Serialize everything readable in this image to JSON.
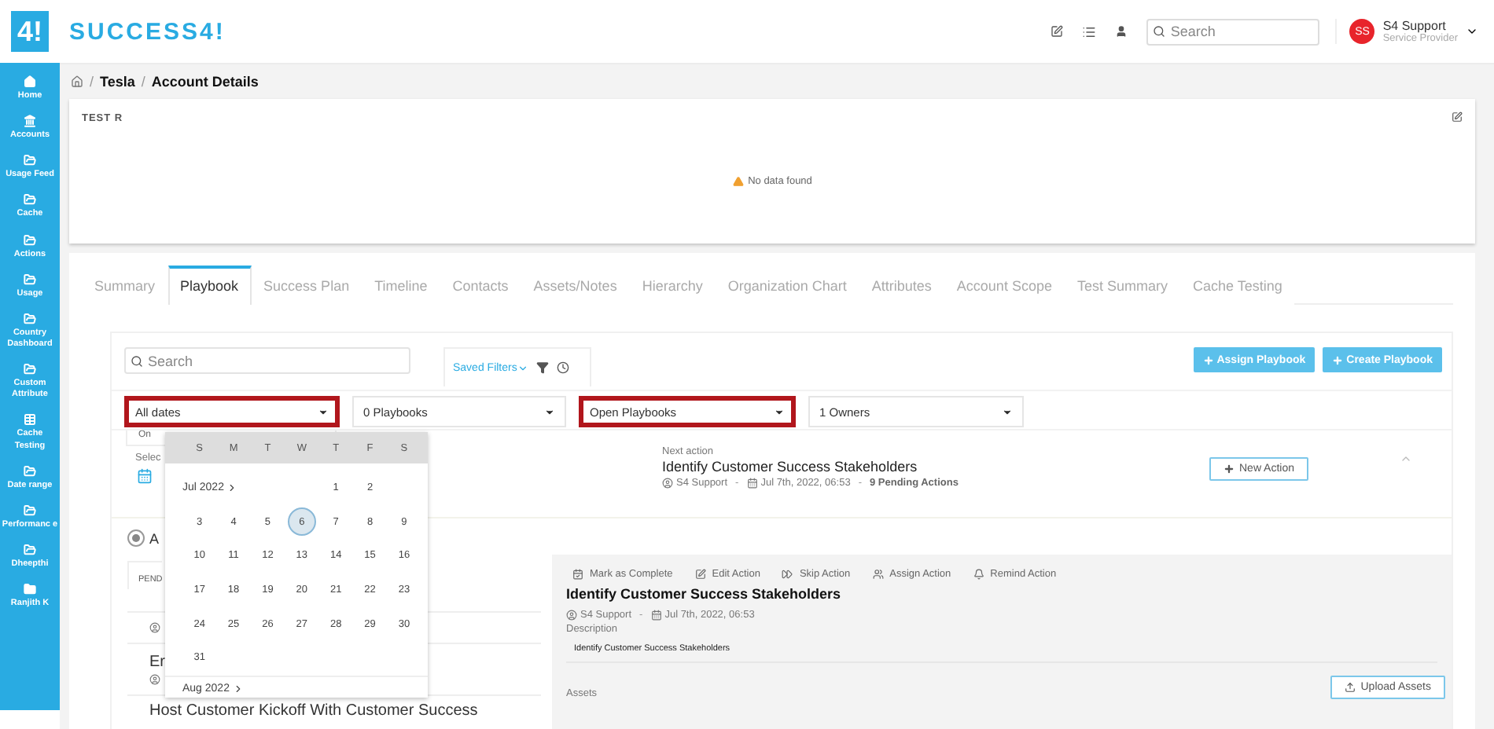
{
  "sidebar": {
    "logo_mark": "4!",
    "items": [
      {
        "label": "Home",
        "kind": "home"
      },
      {
        "label": "Accounts",
        "kind": "bank"
      },
      {
        "label": "Usage Feed",
        "kind": "folder"
      },
      {
        "label": "Cache",
        "kind": "folder"
      },
      {
        "label": "Actions",
        "kind": "folder"
      },
      {
        "label": "Usage",
        "kind": "folder"
      },
      {
        "label": "Country Dashboard",
        "kind": "folder"
      },
      {
        "label": "Custom Attribute",
        "kind": "folder"
      },
      {
        "label": "Cache Testing",
        "kind": "table"
      },
      {
        "label": "Date range",
        "kind": "folder"
      },
      {
        "label": "Performanc e",
        "kind": "folder"
      },
      {
        "label": "Dheepthi",
        "kind": "folder"
      },
      {
        "label": "Ranjith K",
        "kind": "folder-solid"
      }
    ]
  },
  "header": {
    "logo_text": "SUCCESS4!",
    "search_placeholder": "Search",
    "user": {
      "initials": "SS",
      "name": "S4 Support",
      "role": "Service Provider"
    }
  },
  "breadcrumb": {
    "separator": "/",
    "items": [
      "Tesla",
      "Account Details"
    ]
  },
  "account_card": {
    "title": "TEST R",
    "message": "No data found"
  },
  "tabs": [
    {
      "label": "Summary",
      "selected": false
    },
    {
      "label": "Playbook",
      "selected": true
    },
    {
      "label": "Success Plan",
      "selected": false
    },
    {
      "label": "Timeline",
      "selected": false
    },
    {
      "label": "Contacts",
      "selected": false
    },
    {
      "label": "Assets/Notes",
      "selected": false
    },
    {
      "label": "Hierarchy",
      "selected": false
    },
    {
      "label": "Organization Chart",
      "selected": false
    },
    {
      "label": "Attributes",
      "selected": false
    },
    {
      "label": "Account Scope",
      "selected": false
    },
    {
      "label": "Test Summary",
      "selected": false
    },
    {
      "label": "Cache Testing",
      "selected": false
    }
  ],
  "playbook_panel": {
    "search_placeholder": "Search",
    "saved_filters": "Saved Filters",
    "buttons": [
      "Assign Playbook",
      "Create Playbook"
    ],
    "filters": [
      {
        "value": "All dates",
        "highlighted": true
      },
      {
        "value": "0 Playbooks",
        "highlighted": false
      },
      {
        "value": "Open Playbooks",
        "highlighted": true
      },
      {
        "value": "1 Owners",
        "highlighted": false
      }
    ],
    "date_option": "On",
    "select_label": "Selec",
    "radio": {
      "label": "A",
      "selected": true
    },
    "pending_tab": "PEND",
    "list_items": [
      "Er",
      "Host Customer Kickoff With Customer Success"
    ],
    "next_action": {
      "label": "Next action",
      "title": "Identify Customer Success Stakeholders",
      "owner": "S4 Support",
      "separator": "-",
      "date": "Jul 7th, 2022, 06:53",
      "pending": "9 Pending Actions",
      "button": "New Action"
    },
    "detail": {
      "actions": [
        {
          "label": "Mark as Complete",
          "kind": "complete"
        },
        {
          "label": "Edit Action",
          "kind": "edit"
        },
        {
          "label": "Skip Action",
          "kind": "skip"
        },
        {
          "label": "Assign Action",
          "kind": "assign"
        },
        {
          "label": "Remind Action",
          "kind": "remind"
        }
      ],
      "title": "Identify Customer Success Stakeholders",
      "owner": "S4 Support",
      "separator": "-",
      "date": "Jul 7th, 2022, 06:53",
      "description_label": "Description",
      "description": "Identify Customer Success Stakeholders",
      "assets_label": "Assets",
      "upload_button": "Upload Assets"
    }
  },
  "calendar": {
    "weekdays": [
      "S",
      "M",
      "T",
      "W",
      "T",
      "F",
      "S"
    ],
    "months": [
      {
        "label": "Jul 2022",
        "weeks": [
          [
            {
              "day": "1",
              "selected": false
            },
            {
              "day": "2",
              "selected": false
            }
          ],
          [
            {
              "day": "3",
              "selected": false
            },
            {
              "day": "4",
              "selected": false
            },
            {
              "day": "5",
              "selected": false
            },
            {
              "day": "6",
              "selected": true
            },
            {
              "day": "7",
              "selected": false
            },
            {
              "day": "8",
              "selected": false
            },
            {
              "day": "9",
              "selected": false
            }
          ],
          [
            {
              "day": "10",
              "selected": false
            },
            {
              "day": "11",
              "selected": false
            },
            {
              "day": "12",
              "selected": false
            },
            {
              "day": "13",
              "selected": false
            },
            {
              "day": "14",
              "selected": false
            },
            {
              "day": "15",
              "selected": false
            },
            {
              "day": "16",
              "selected": false
            }
          ],
          [
            {
              "day": "17",
              "selected": false
            },
            {
              "day": "18",
              "selected": false
            },
            {
              "day": "19",
              "selected": false
            },
            {
              "day": "20",
              "selected": false
            },
            {
              "day": "21",
              "selected": false
            },
            {
              "day": "22",
              "selected": false
            },
            {
              "day": "23",
              "selected": false
            }
          ],
          [
            {
              "day": "24",
              "selected": false
            },
            {
              "day": "25",
              "selected": false
            },
            {
              "day": "26",
              "selected": false
            },
            {
              "day": "27",
              "selected": false
            },
            {
              "day": "28",
              "selected": false
            },
            {
              "day": "29",
              "selected": false
            },
            {
              "day": "30",
              "selected": false
            }
          ],
          [
            {
              "day": "31",
              "selected": false
            }
          ]
        ]
      },
      {
        "label": "Aug 2022"
      }
    ]
  }
}
